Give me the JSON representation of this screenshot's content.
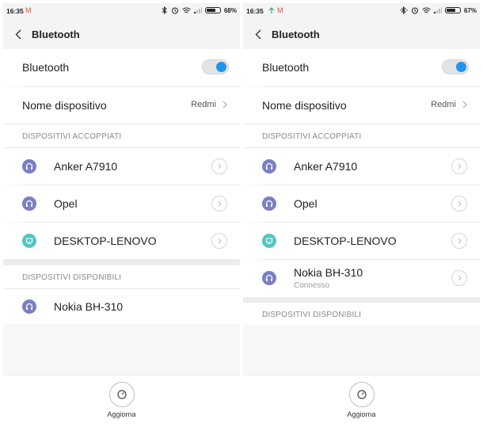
{
  "screens": [
    {
      "status": {
        "time": "16:35",
        "battery": "68%",
        "notif": "M"
      },
      "title": "Bluetooth",
      "bluetooth_label": "Bluetooth",
      "bluetooth_on": true,
      "device_name_label": "Nome dispositivo",
      "device_name_value": "Redmi",
      "paired_header": "DISPOSITIVI ACCOPPIATI",
      "paired": [
        {
          "name": "Anker A7910",
          "icon": "headset-icon"
        },
        {
          "name": "Opel",
          "icon": "headset-icon"
        },
        {
          "name": "DESKTOP-LENOVO",
          "icon": "computer-icon"
        }
      ],
      "available_header": "DISPOSITIVI DISPONIBILI",
      "available": [
        {
          "name": "Nokia BH-310",
          "icon": "headset-icon"
        }
      ],
      "refresh_label": "Aggiorna"
    },
    {
      "status": {
        "time": "16:35",
        "battery": "67%",
        "notif": "M"
      },
      "title": "Bluetooth",
      "bluetooth_label": "Bluetooth",
      "bluetooth_on": true,
      "device_name_label": "Nome dispositivo",
      "device_name_value": "Redmi",
      "paired_header": "DISPOSITIVI ACCOPPIATI",
      "paired": [
        {
          "name": "Anker A7910",
          "icon": "headset-icon"
        },
        {
          "name": "Opel",
          "icon": "headset-icon"
        },
        {
          "name": "DESKTOP-LENOVO",
          "icon": "computer-icon"
        },
        {
          "name": "Nokia BH-310",
          "sub": "Connesso",
          "icon": "headset-icon"
        }
      ],
      "available_header": "DISPOSITIVI DISPONIBILI",
      "available": [],
      "refresh_label": "Aggiorna"
    }
  ],
  "colors": {
    "toggle_on": "#1e96f0",
    "headset": "#7b7fc4",
    "computer": "#52c7c4"
  }
}
